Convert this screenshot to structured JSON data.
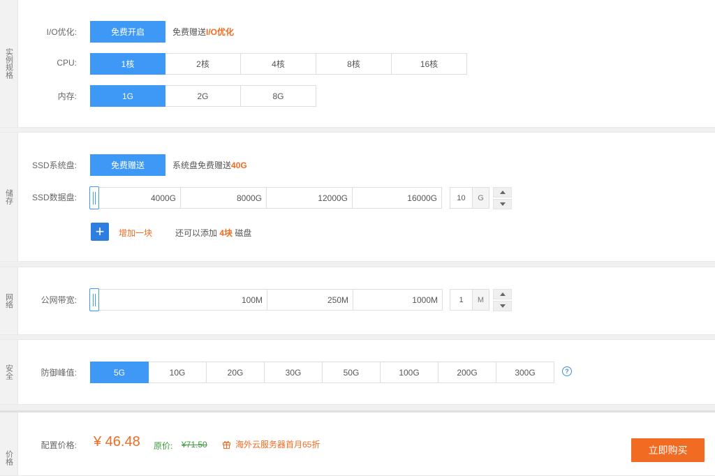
{
  "spec": {
    "side_label": "实例规格",
    "io": {
      "label": "I/O优化:",
      "option": "免费开启",
      "note_prefix": "免费赠送",
      "note_highlight": "I/O优化"
    },
    "cpu": {
      "label": "CPU:",
      "options": [
        "1核",
        "2核",
        "4核",
        "8核",
        "16核"
      ],
      "selected": "1核"
    },
    "memory": {
      "label": "内存:",
      "options": [
        "1G",
        "2G",
        "8G"
      ],
      "selected": "1G"
    }
  },
  "storage": {
    "side_label": "储存",
    "system_disk": {
      "label": "SSD系统盘:",
      "option": "免费赠送",
      "note_prefix": "系统盘免费赠送",
      "note_highlight": "40G"
    },
    "data_disk": {
      "label": "SSD数据盘:",
      "ticks": [
        "4000G",
        "8000G",
        "12000G",
        "16000G"
      ],
      "value": "10",
      "unit": "G"
    },
    "add": {
      "label": "增加一块",
      "note_prefix": "还可以添加 ",
      "note_highlight": "4块",
      "note_suffix": " 磁盘"
    }
  },
  "network": {
    "side_label": "网络",
    "bandwidth": {
      "label": "公网带宽:",
      "ticks": [
        "100M",
        "250M",
        "1000M"
      ],
      "value": "1",
      "unit": "M"
    }
  },
  "security": {
    "side_label": "安全",
    "ddos": {
      "label": "防御峰值:",
      "options": [
        "5G",
        "10G",
        "20G",
        "30G",
        "50G",
        "100G",
        "200G",
        "300G"
      ],
      "selected": "5G"
    },
    "help_icon": "question-circle-icon"
  },
  "pricing": {
    "side_label": "价格",
    "label": "配置价格:",
    "price": "¥ 46.48",
    "original_label": "原价:",
    "original_price": "¥71.50",
    "promo": "海外云服务器首月65折",
    "buy_button": "立即购买"
  },
  "colors": {
    "accent": "#3d99f5",
    "orange": "#f26b22",
    "plus_button": "#2e7de1",
    "strike_price": "#3a9a3a"
  }
}
